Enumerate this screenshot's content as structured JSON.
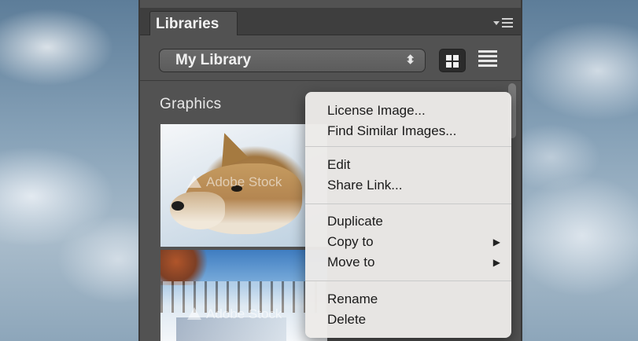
{
  "panel": {
    "tab_label": "Libraries",
    "menu_icon": "panel-menu-icon",
    "library_select": {
      "value": "My Library",
      "arrows": "⬍"
    },
    "view_grid_icon": "grid-view-icon",
    "view_list_icon": "list-view-icon",
    "section_label": "Graphics",
    "thumbnails": [
      {
        "watermark": "Adobe Stock"
      },
      {
        "watermark": "Adobe Stock"
      }
    ]
  },
  "context_menu": {
    "items": [
      {
        "label": "License Image..."
      },
      {
        "label": "Find Similar Images..."
      },
      {
        "label": "Edit"
      },
      {
        "label": "Share Link..."
      },
      {
        "label": "Duplicate"
      },
      {
        "label": "Copy to",
        "submenu_arrow": "▶"
      },
      {
        "label": "Move to",
        "submenu_arrow": "▶"
      },
      {
        "label": "Rename"
      },
      {
        "label": "Delete"
      }
    ]
  }
}
